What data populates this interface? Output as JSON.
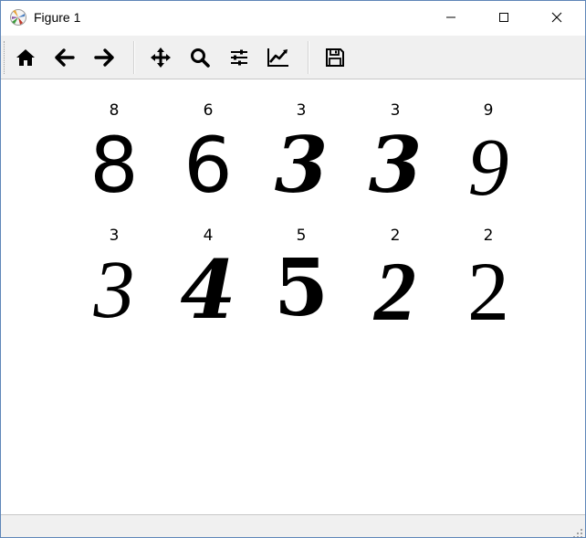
{
  "window": {
    "title": "Figure 1"
  },
  "titlebar_buttons": {
    "minimize": "minimize-icon",
    "maximize": "maximize-icon",
    "close": "close-icon"
  },
  "toolbar": {
    "tools": [
      "home-icon",
      "back-arrow-icon",
      "forward-arrow-icon",
      "pan-icon",
      "zoom-icon",
      "subplots-icon",
      "edit-axis-icon",
      "save-icon"
    ]
  },
  "figure": {
    "rows": [
      [
        {
          "title": "8",
          "glyph": "8"
        },
        {
          "title": "6",
          "glyph": "6"
        },
        {
          "title": "3",
          "glyph": "3"
        },
        {
          "title": "3",
          "glyph": "3"
        },
        {
          "title": "9",
          "glyph": "9"
        }
      ],
      [
        {
          "title": "3",
          "glyph": "3"
        },
        {
          "title": "4",
          "glyph": "4"
        },
        {
          "title": "5",
          "glyph": "5"
        },
        {
          "title": "2",
          "glyph": "2"
        },
        {
          "title": "2",
          "glyph": "2"
        }
      ]
    ]
  },
  "colors": {
    "window_border": "#5f86b8",
    "toolbar_bg": "#f0f0f0",
    "canvas_bg": "#ffffff"
  }
}
